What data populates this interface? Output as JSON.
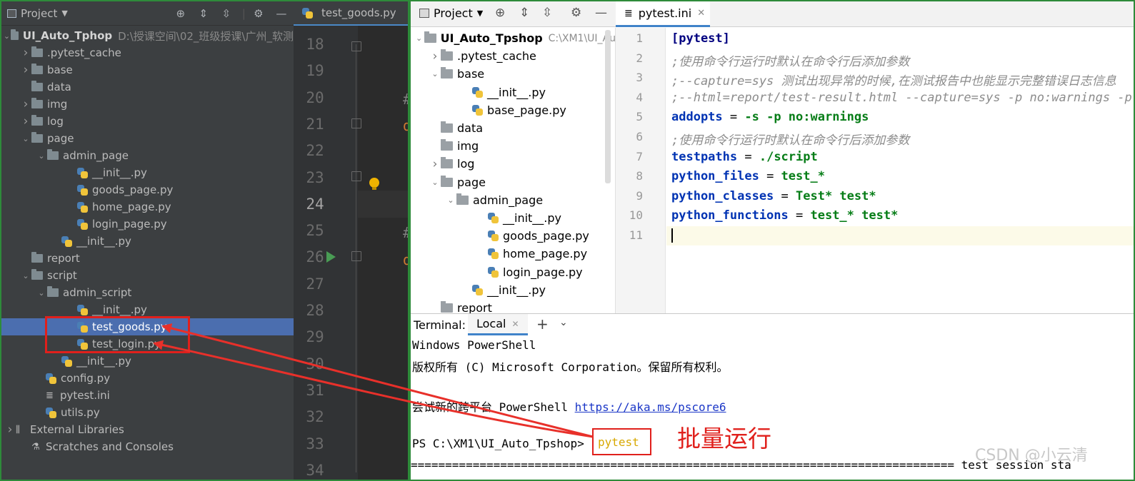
{
  "left": {
    "toolbar": {
      "project_label": "Project",
      "tab_label": "test_goods.py"
    },
    "tree": [
      {
        "label": "UI_Auto_Tphop",
        "path": "D:\\授课空间\\02_班级授课\\广州_软测",
        "kind": "root"
      },
      {
        "label": ".pytest_cache",
        "kind": "folder"
      },
      {
        "label": "base",
        "kind": "folder"
      },
      {
        "label": "data",
        "kind": "folder"
      },
      {
        "label": "img",
        "kind": "folder"
      },
      {
        "label": "log",
        "kind": "folder"
      },
      {
        "label": "page",
        "kind": "folder"
      },
      {
        "label": "admin_page",
        "kind": "folder"
      },
      {
        "label": "__init__.py",
        "kind": "py"
      },
      {
        "label": "goods_page.py",
        "kind": "py"
      },
      {
        "label": "home_page.py",
        "kind": "py"
      },
      {
        "label": "login_page.py",
        "kind": "py"
      },
      {
        "label": "__init__.py",
        "kind": "py"
      },
      {
        "label": "report",
        "kind": "folder"
      },
      {
        "label": "script",
        "kind": "folder"
      },
      {
        "label": "admin_script",
        "kind": "folder"
      },
      {
        "label": "__init__.py",
        "kind": "py"
      },
      {
        "label": "test_goods.py",
        "kind": "py"
      },
      {
        "label": "test_login.py",
        "kind": "py"
      },
      {
        "label": "__init__.py",
        "kind": "py"
      },
      {
        "label": "config.py",
        "kind": "py"
      },
      {
        "label": "pytest.ini",
        "kind": "ini"
      },
      {
        "label": "utils.py",
        "kind": "py"
      },
      {
        "label": "External Libraries",
        "kind": "lib"
      },
      {
        "label": "Scratches and Consoles",
        "kind": "scratch"
      }
    ],
    "line_numbers": [
      "18",
      "19",
      "20",
      "21",
      "22",
      "23",
      "24",
      "25",
      "26",
      "27",
      "28",
      "29",
      "30",
      "31",
      "32",
      "33",
      "34"
    ],
    "cut_chars": [
      "#",
      "d",
      "#",
      "d"
    ]
  },
  "right": {
    "toolbar": {
      "project_label": "Project",
      "tab_label": "pytest.ini"
    },
    "tree": [
      {
        "label": "UI_Auto_Tpshop",
        "path": "C:\\XM1\\UI_Au"
      },
      {
        "label": ".pytest_cache"
      },
      {
        "label": "base"
      },
      {
        "label": "__init__.py"
      },
      {
        "label": "base_page.py"
      },
      {
        "label": "data"
      },
      {
        "label": "img"
      },
      {
        "label": "log"
      },
      {
        "label": "page"
      },
      {
        "label": "admin_page"
      },
      {
        "label": "__init__.py"
      },
      {
        "label": "goods_page.py"
      },
      {
        "label": "home_page.py"
      },
      {
        "label": "login_page.py"
      },
      {
        "label": "__init__.py"
      },
      {
        "label": "report"
      }
    ],
    "code_lines": [
      {
        "n": "1",
        "text": "[pytest]"
      },
      {
        "n": "2",
        "text": ";使用命令行运行时默认在命令行后添加参数"
      },
      {
        "n": "3",
        "text": ";--capture=sys 测试出现异常的时候,在测试报告中也能显示完整错误日志信息"
      },
      {
        "n": "4",
        "text": ";--html=report/test-result.html --capture=sys -p no:warnings -p"
      },
      {
        "n": "5",
        "key": "addopts",
        "value": "-s -p no:warnings"
      },
      {
        "n": "6",
        "text": ";使用命令行运行时默认在命令行后添加参数"
      },
      {
        "n": "7",
        "key": "testpaths",
        "value": "./script"
      },
      {
        "n": "8",
        "key": "python_files",
        "value": "test_*"
      },
      {
        "n": "9",
        "key": "python_classes",
        "value": "Test* test*"
      },
      {
        "n": "10",
        "key": "python_functions",
        "value": "test_* test*"
      },
      {
        "n": "11",
        "text": ""
      }
    ],
    "terminal": {
      "title": "Terminal:",
      "tab": "Local",
      "lines": [
        "Windows PowerShell",
        "版权所有 (C) Microsoft Corporation。保留所有权利。",
        "",
        "尝试新的跨平台 PowerShell ",
        "",
        "PS C:\\XM1\\UI_Auto_Tpshop> "
      ],
      "link": "https://aka.ms/pscore6",
      "command": "pytest",
      "separator": "=============================================================================== test session sta"
    },
    "annotation": "批量运行",
    "watermark": "CSDN @小云清"
  },
  "colors": {
    "highlight_red": "#e0201c",
    "pane_border_green": "#2e8b3a",
    "selection_blue": "#4b6eaf",
    "py_blue": "#4a7fb5",
    "py_yellow": "#f0c43a"
  }
}
